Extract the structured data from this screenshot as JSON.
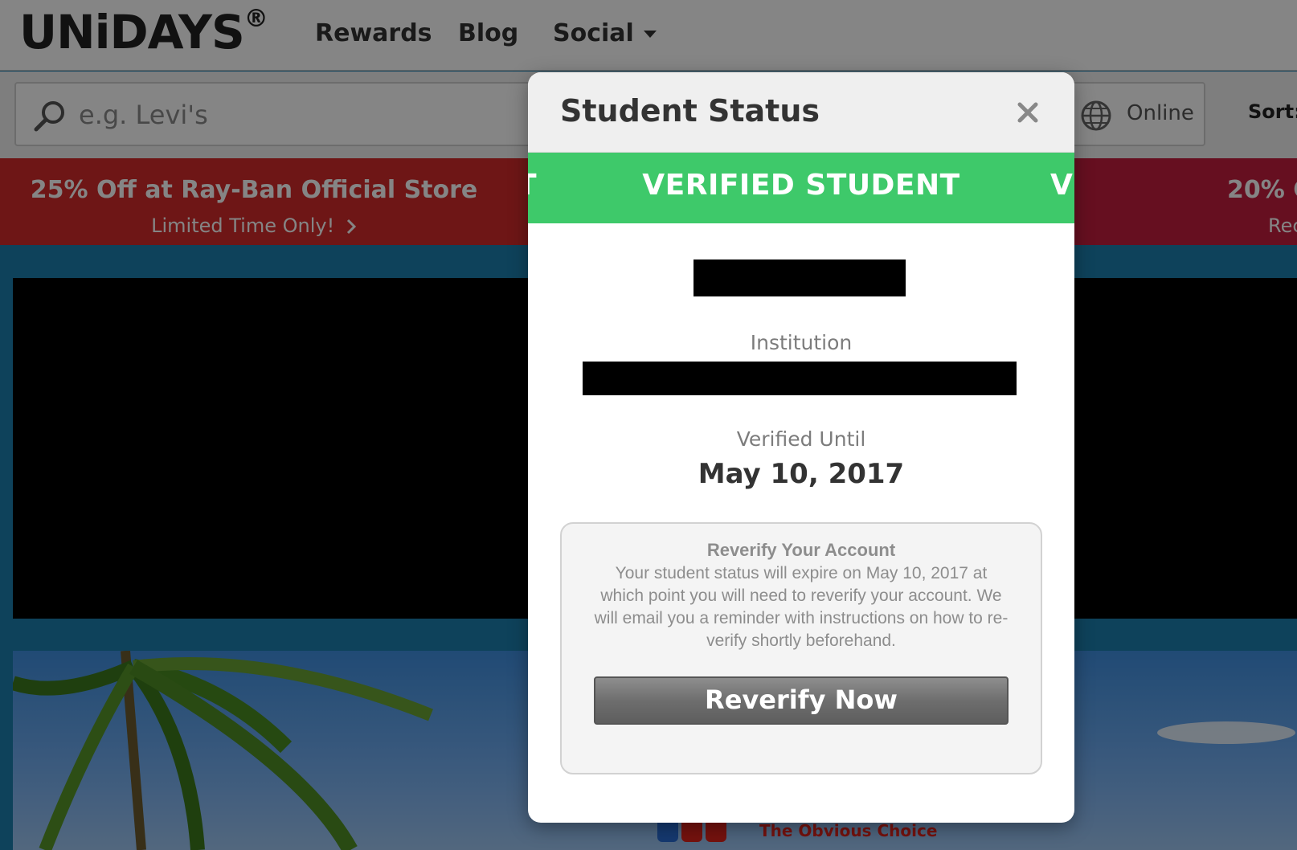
{
  "header": {
    "logo": "UNiDAYS",
    "logo_mark": "®",
    "nav": {
      "rewards": "Rewards",
      "blog": "Blog",
      "social": "Social"
    }
  },
  "search": {
    "placeholder": "e.g. Levi's",
    "channel": "Online",
    "sort_label": "Sort:"
  },
  "promo": {
    "title": "25% Off at Ray-Ban Official Store",
    "subtitle": "Limited Time Only!",
    "next_title": "20% C",
    "next_subtitle": "Rec"
  },
  "hero": {
    "tagline": "The Obvious Choice"
  },
  "modal": {
    "title": "Student Status",
    "banner": "VERIFIED STUDENT",
    "banner_ghost_left": "T",
    "banner_ghost_right": "V",
    "institution_label": "Institution",
    "verified_until_label": "Verified Until",
    "verified_until_value": "May 10, 2017",
    "reverify": {
      "title": "Reverify Your Account",
      "body": "Your student status will expire on May 10, 2017 at which point you will need to reverify your account. We will email you a reminder with instructions on how to re-verify shortly beforehand.",
      "button": "Reverify Now"
    }
  },
  "colors": {
    "verified_green": "#3ec96a",
    "promo_red": "#d42b2b",
    "page_blue": "#1b7fae"
  },
  "icons": [
    "search-icon",
    "globe-icon",
    "close-icon",
    "chevron-right-icon",
    "caret-down-icon"
  ]
}
